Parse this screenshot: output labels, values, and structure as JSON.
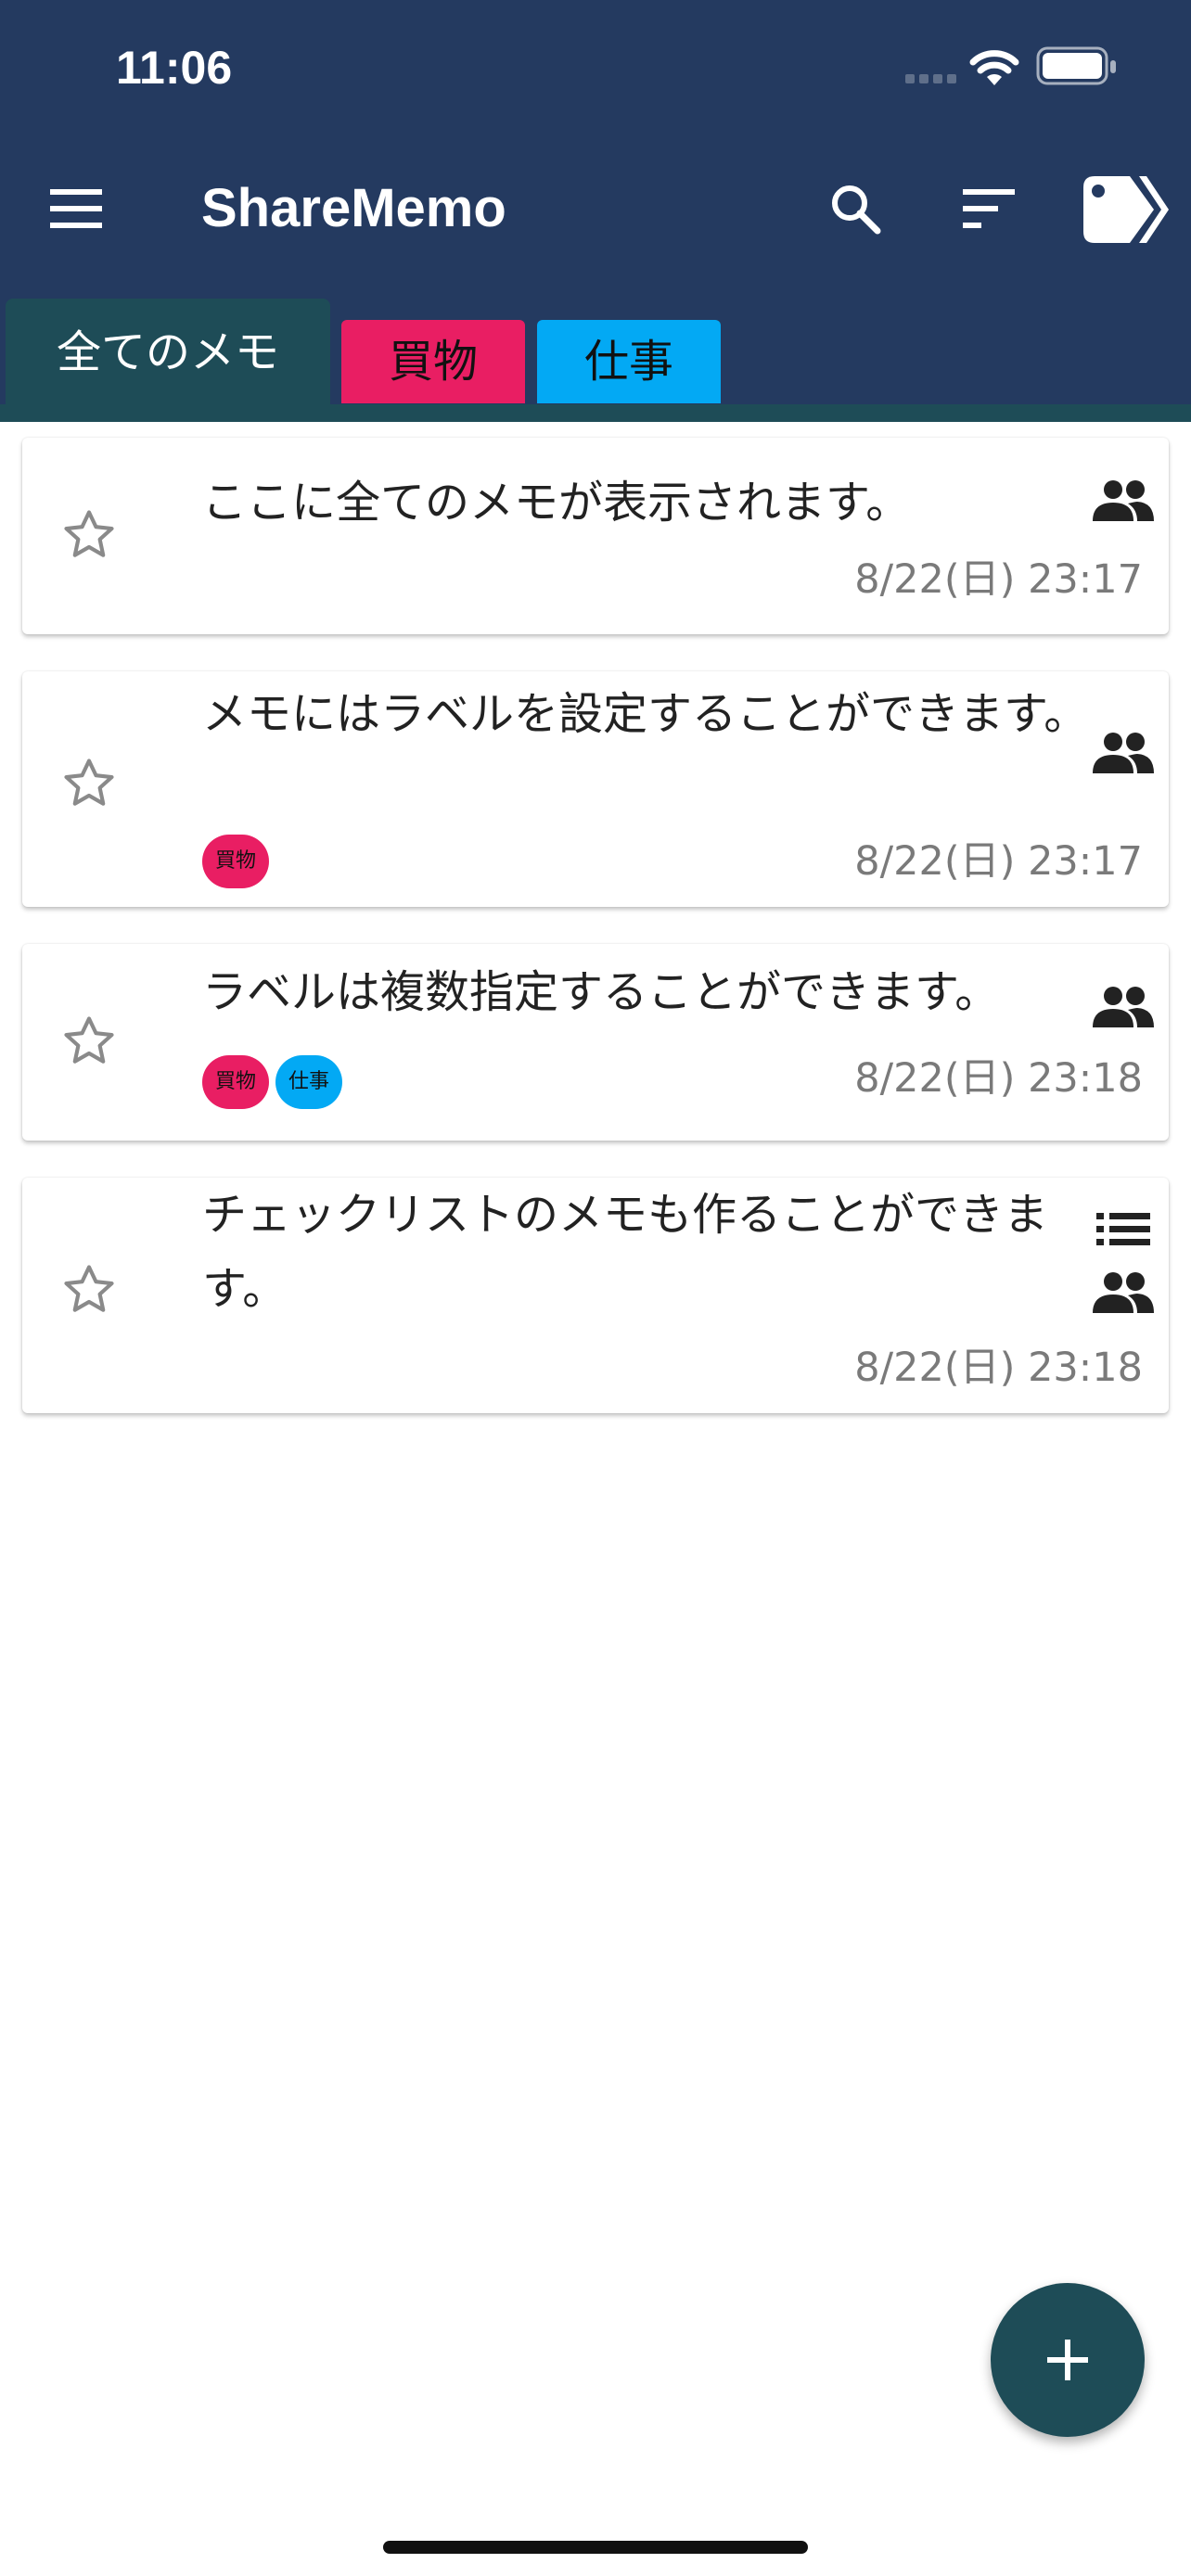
{
  "status_bar": {
    "time": "11:06"
  },
  "app_bar": {
    "title": "ShareMemo"
  },
  "tabs": [
    {
      "label": "全てのメモ",
      "selected": true
    },
    {
      "label": "買物",
      "color": "#e91e63"
    },
    {
      "label": "仕事",
      "color": "#03a9f4"
    }
  ],
  "memos": [
    {
      "text": "ここに全てのメモが表示されます。",
      "date": "8/22(日) 23:17",
      "labels": [],
      "icons": [
        "people-icon"
      ]
    },
    {
      "text": "メモにはラベルを設定することができます。",
      "date": "8/22(日) 23:17",
      "labels": [
        "買物"
      ],
      "icons": [
        "people-icon"
      ]
    },
    {
      "text": "ラベルは複数指定することができます。",
      "date": "8/22(日) 23:18",
      "labels": [
        "買物",
        "仕事"
      ],
      "icons": [
        "people-icon"
      ]
    },
    {
      "text": "チェックリストのメモも作ることができます。",
      "date": "8/22(日) 23:18",
      "labels": [],
      "icons": [
        "checklist-icon",
        "people-icon"
      ]
    }
  ],
  "colors": {
    "header": "#243a60",
    "accent": "#1e4c57",
    "label_shopping": "#e91e63",
    "label_work": "#03a9f4"
  }
}
